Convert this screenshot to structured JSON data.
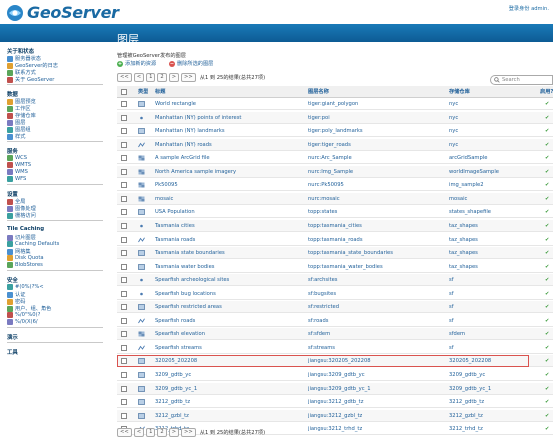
{
  "header": {
    "brand": "GeoServer",
    "login_text": "登录身份 admin."
  },
  "sidebar": {
    "sections": [
      {
        "label": "关于和状态",
        "items": [
          {
            "label": "服务器状态",
            "icon": "server-status-icon"
          },
          {
            "label": "GeoServer的日志",
            "icon": "log-icon"
          },
          {
            "label": "联系方式",
            "icon": "contact-icon"
          },
          {
            "label": "关于 GeoServer",
            "icon": "about-icon"
          }
        ]
      },
      {
        "label": "数据",
        "items": [
          {
            "label": "图层预览",
            "icon": "layer-preview-icon"
          },
          {
            "label": "工作区",
            "icon": "workspace-icon"
          },
          {
            "label": "存储仓库",
            "icon": "store-icon"
          },
          {
            "label": "图层",
            "icon": "layers-icon"
          },
          {
            "label": "图层组",
            "icon": "layer-group-icon"
          },
          {
            "label": "样式",
            "icon": "styles-icon"
          }
        ]
      },
      {
        "label": "服务",
        "items": [
          {
            "label": "WCS",
            "icon": "wcs-icon"
          },
          {
            "label": "WMTS",
            "icon": "wmts-icon"
          },
          {
            "label": "WMS",
            "icon": "wms-icon"
          },
          {
            "label": "WFS",
            "icon": "wfs-icon"
          }
        ]
      },
      {
        "label": "设置",
        "items": [
          {
            "label": "全局",
            "icon": "global-icon"
          },
          {
            "label": "图像处理",
            "icon": "image-processing-icon"
          },
          {
            "label": "栅格访问",
            "icon": "raster-access-icon"
          }
        ]
      },
      {
        "label": "Tile Caching",
        "items": [
          {
            "label": "切片图层",
            "icon": "tile-layers-icon"
          },
          {
            "label": "Caching Defaults",
            "icon": "caching-defaults-icon"
          },
          {
            "label": "网格集",
            "icon": "gridsets-icon"
          },
          {
            "label": "Disk Quota",
            "icon": "disk-quota-icon"
          },
          {
            "label": "BlobStores",
            "icon": "blobstores-icon"
          }
        ]
      },
      {
        "label": "安全",
        "items": [
          {
            "label": "#(0%(?%<",
            "icon": "security-settings-icon"
          },
          {
            "label": "认证",
            "icon": "authentication-icon"
          },
          {
            "label": "密码",
            "icon": "passwords-icon"
          },
          {
            "label": "用户、组、角色",
            "icon": "users-groups-roles-icon"
          },
          {
            "label": "%/0\"%0(?",
            "icon": "data-security-icon"
          },
          {
            "label": "%/0(X(6/",
            "icon": "service-security-icon"
          }
        ]
      },
      {
        "label": "演示",
        "items": []
      },
      {
        "label": "工具",
        "items": []
      }
    ]
  },
  "main": {
    "title": "图层",
    "description": "管理被GeoServer发布的图层",
    "add_label": "添加新的资源",
    "remove_label": "删除所选的图层",
    "pager": {
      "first": "<<",
      "prev": "<",
      "page1": "1",
      "page2": "2",
      "next": ">",
      "last": ">>",
      "info": "从1 到 25的结果(总共27项)"
    },
    "bottom_pager_info": "从1 到 25的结果(总共27项)",
    "search_placeholder": "Search",
    "columns": {
      "type": "类型",
      "title": "标题",
      "name": "图层名称",
      "store": "存储仓库",
      "enabled": "启用?"
    },
    "rows": [
      {
        "type": "polygon",
        "title": "World rectangle",
        "name": "tiger:giant_polygon",
        "store": "nyc",
        "enabled": "✔"
      },
      {
        "type": "point",
        "title": "Manhattan (NY) points of interest",
        "name": "tiger:poi",
        "store": "nyc",
        "enabled": "✔"
      },
      {
        "type": "polygon",
        "title": "Manhattan (NY) landmarks",
        "name": "tiger:poly_landmarks",
        "store": "nyc",
        "enabled": "✔"
      },
      {
        "type": "line",
        "title": "Manhattan (NY) roads",
        "name": "tiger:tiger_roads",
        "store": "nyc",
        "enabled": "✔"
      },
      {
        "type": "raster",
        "title": "A sample ArcGrid file",
        "name": "nurc:Arc_Sample",
        "store": "arcGridSample",
        "enabled": "✔"
      },
      {
        "type": "raster",
        "title": "North America sample imagery",
        "name": "nurc:Img_Sample",
        "store": "worldImageSample",
        "enabled": "✔"
      },
      {
        "type": "raster",
        "title": "Pk50095",
        "name": "nurc:Pk50095",
        "store": "img_sample2",
        "enabled": "✔"
      },
      {
        "type": "raster",
        "title": "mosaic",
        "name": "nurc:mosaic",
        "store": "mosaic",
        "enabled": "✔"
      },
      {
        "type": "polygon",
        "title": "USA Population",
        "name": "topp:states",
        "store": "states_shapefile",
        "enabled": "✔"
      },
      {
        "type": "point",
        "title": "Tasmania cities",
        "name": "topp:tasmania_cities",
        "store": "taz_shapes",
        "enabled": "✔"
      },
      {
        "type": "line",
        "title": "Tasmania roads",
        "name": "topp:tasmania_roads",
        "store": "taz_shapes",
        "enabled": "✔"
      },
      {
        "type": "polygon",
        "title": "Tasmania state boundaries",
        "name": "topp:tasmania_state_boundaries",
        "store": "taz_shapes",
        "enabled": "✔"
      },
      {
        "type": "polygon",
        "title": "Tasmania water bodies",
        "name": "topp:tasmania_water_bodies",
        "store": "taz_shapes",
        "enabled": "✔"
      },
      {
        "type": "point",
        "title": "Spearfish archeological sites",
        "name": "sf:archsites",
        "store": "sf",
        "enabled": "✔"
      },
      {
        "type": "point",
        "title": "Spearfish bug locations",
        "name": "sf:bugsites",
        "store": "sf",
        "enabled": "✔"
      },
      {
        "type": "polygon",
        "title": "Spearfish restricted areas",
        "name": "sf:restricted",
        "store": "sf",
        "enabled": "✔"
      },
      {
        "type": "line",
        "title": "Spearfish roads",
        "name": "sf:roads",
        "store": "sf",
        "enabled": "✔"
      },
      {
        "type": "raster",
        "title": "Spearfish elevation",
        "name": "sf:sfdem",
        "store": "sfdem",
        "enabled": "✔"
      },
      {
        "type": "line",
        "title": "Spearfish streams",
        "name": "sf:streams",
        "store": "sf",
        "enabled": "✔"
      },
      {
        "type": "polygon",
        "title": "320205_202208",
        "name": "jiangsu:320205_202208",
        "store": "320205_202208",
        "enabled": "✔"
      },
      {
        "type": "polygon",
        "title": "3209_gdtb_yc",
        "name": "jiangsu:3209_gdtb_yc",
        "store": "3209_gdtb_yc",
        "enabled": "✔"
      },
      {
        "type": "polygon",
        "title": "3209_gdtb_yc_1",
        "name": "jiangsu:3209_gdtb_yc_1",
        "store": "3209_gdtb_yc_1",
        "enabled": "✔"
      },
      {
        "type": "polygon",
        "title": "3212_gdtb_tz",
        "name": "jiangsu:3212_gdtb_tz",
        "store": "3212_gdtb_tz",
        "enabled": "✔"
      },
      {
        "type": "polygon",
        "title": "3212_gzbl_tz",
        "name": "jiangsu:3212_gzbl_tz",
        "store": "3212_gzbl_tz",
        "enabled": "✔"
      },
      {
        "type": "line",
        "title": "3212_trhd_tz",
        "name": "jiangsu:3212_trhd_tz",
        "store": "3212_trhd_tz",
        "enabled": "✔"
      }
    ]
  },
  "colors": {
    "brand": "#1a6aa3",
    "banner": "#1a7ab8",
    "enabled": "#3a9a3a",
    "highlight": "#d9534f",
    "add": "#4caf50",
    "remove": "#d9534f"
  }
}
